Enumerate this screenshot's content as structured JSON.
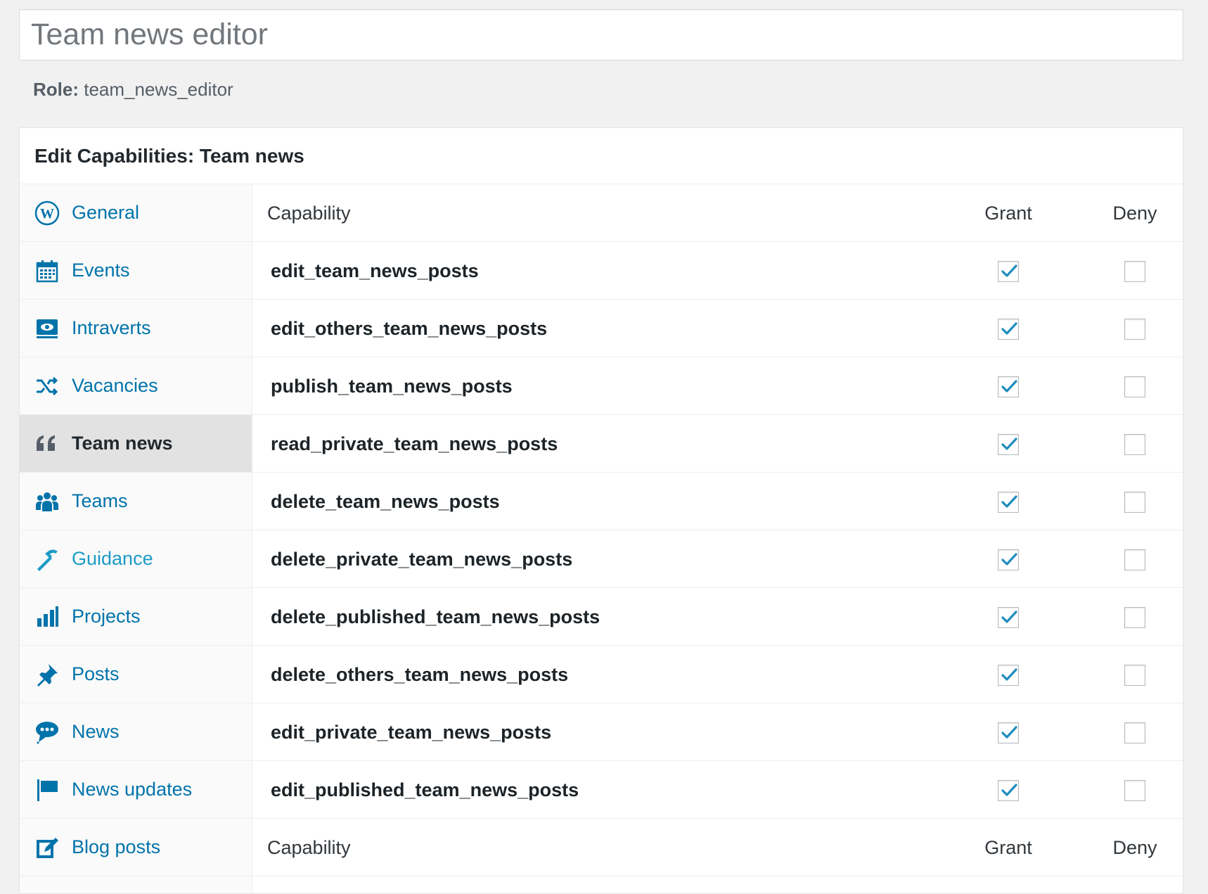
{
  "title_field": {
    "value": "Team news editor"
  },
  "role": {
    "label": "Role:",
    "value": "team_news_editor"
  },
  "panel": {
    "heading": "Edit Capabilities: Team news",
    "tabs": [
      {
        "label": "General",
        "icon": "wordpress-icon",
        "active": false
      },
      {
        "label": "Events",
        "icon": "calendar-icon",
        "active": false
      },
      {
        "label": "Intraverts",
        "icon": "welcome-view-site-icon",
        "active": false
      },
      {
        "label": "Vacancies",
        "icon": "randomize-icon",
        "active": false
      },
      {
        "label": "Team news",
        "icon": "quote-icon",
        "active": true
      },
      {
        "label": "Teams",
        "icon": "groups-icon",
        "active": false
      },
      {
        "label": "Guidance",
        "icon": "hammer-icon",
        "active": false
      },
      {
        "label": "Projects",
        "icon": "chart-bar-icon",
        "active": false
      },
      {
        "label": "Posts",
        "icon": "pushpin-icon",
        "active": false
      },
      {
        "label": "News",
        "icon": "speech-bubble-icon",
        "active": false
      },
      {
        "label": "News updates",
        "icon": "flag-icon",
        "active": false
      },
      {
        "label": "Blog posts",
        "icon": "edit-icon",
        "active": false
      }
    ],
    "columns": {
      "capability": "Capability",
      "grant": "Grant",
      "deny": "Deny"
    },
    "capabilities": [
      {
        "name": "edit_team_news_posts",
        "grant": true,
        "deny": false
      },
      {
        "name": "edit_others_team_news_posts",
        "grant": true,
        "deny": false
      },
      {
        "name": "publish_team_news_posts",
        "grant": true,
        "deny": false
      },
      {
        "name": "read_private_team_news_posts",
        "grant": true,
        "deny": false
      },
      {
        "name": "delete_team_news_posts",
        "grant": true,
        "deny": false
      },
      {
        "name": "delete_private_team_news_posts",
        "grant": true,
        "deny": false
      },
      {
        "name": "delete_published_team_news_posts",
        "grant": true,
        "deny": false
      },
      {
        "name": "delete_others_team_news_posts",
        "grant": true,
        "deny": false
      },
      {
        "name": "edit_private_team_news_posts",
        "grant": true,
        "deny": false
      },
      {
        "name": "edit_published_team_news_posts",
        "grant": true,
        "deny": false
      }
    ]
  },
  "colors": {
    "link": "#0073aa",
    "accent_teal": "#1c9bc6",
    "check": "#1e8cbe",
    "active_tab_bg": "#e2e2e2"
  }
}
